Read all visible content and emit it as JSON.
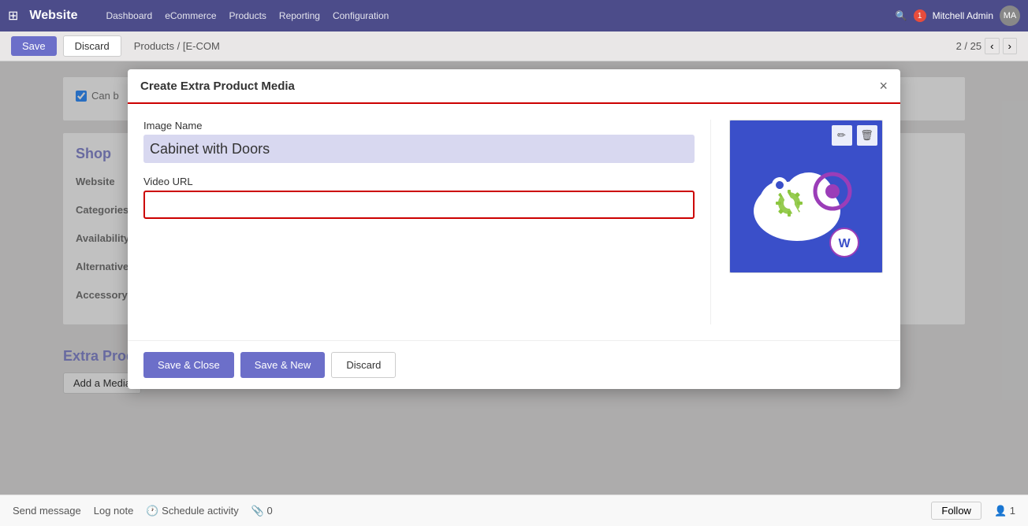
{
  "topbar": {
    "app_name": "Website",
    "nav_items": [
      "Dashboard",
      "eCommerce",
      "Products",
      "Reporting",
      "Configuration"
    ],
    "user_name": "Mitchell Admin",
    "badge_count": "1"
  },
  "breadcrumb": {
    "save_label": "Save",
    "discard_label": "Discard",
    "path": "Products / [E-COM",
    "pagination": "2 / 25"
  },
  "modal": {
    "title": "Create Extra Product Media",
    "close_label": "×",
    "image_name_label": "Image Name",
    "image_name_value": "Cabinet with Doors",
    "video_url_label": "Video URL",
    "video_url_value": "",
    "video_url_placeholder": "",
    "save_close_label": "Save & Close",
    "save_new_label": "Save & New",
    "discard_label": "Discard"
  },
  "background": {
    "shop_section": "Shop",
    "website_label": "Website",
    "categories_label": "Categories",
    "availability_label": "Availability",
    "alternatives_label": "Alternatives",
    "accessory_label": "Accessory Products",
    "extra_media_section": "Extra Product Media",
    "add_media_label": "Add a Media",
    "can_be_sold_label": "Can b"
  },
  "bottom_bar": {
    "send_message": "Send message",
    "log_note": "Log note",
    "schedule_activity": "Schedule activity",
    "attachment_count": "0",
    "follow_label": "Follow",
    "follower_count": "1"
  }
}
